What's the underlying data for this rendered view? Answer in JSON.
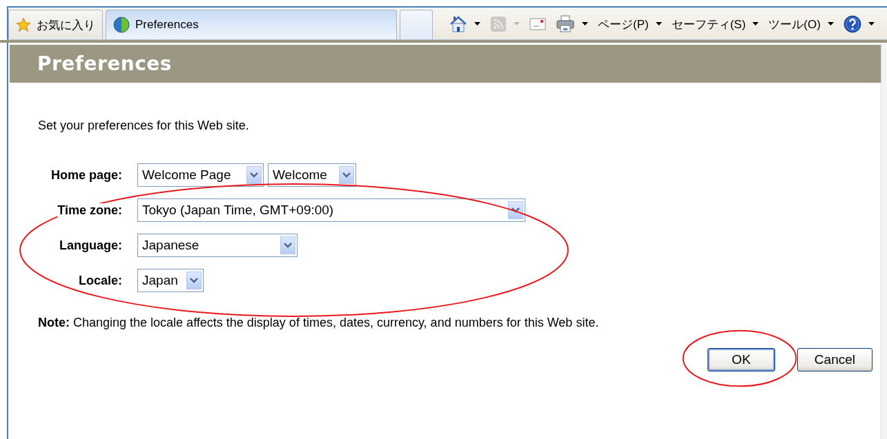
{
  "browser": {
    "tabs": [
      {
        "kind": "favorites",
        "label": "お気に入り",
        "selected": false
      },
      {
        "kind": "page",
        "label": "Preferences",
        "selected": true
      },
      {
        "kind": "new",
        "selected": false
      }
    ],
    "commands": [
      {
        "kind": "home",
        "dropdown": true,
        "disabled": false
      },
      {
        "kind": "feeds",
        "dropdown": true,
        "disabled": true
      },
      {
        "kind": "mail",
        "dropdown": false,
        "disabled": false
      },
      {
        "kind": "print",
        "dropdown": true,
        "disabled": false
      },
      {
        "kind": "menu",
        "label": "ページ(P)",
        "dropdown": true,
        "disabled": false
      },
      {
        "kind": "menu",
        "label": "セーフティ(S)",
        "dropdown": true,
        "disabled": false
      },
      {
        "kind": "menu",
        "label": "ツール(O)",
        "dropdown": true,
        "disabled": false
      },
      {
        "kind": "help",
        "dropdown": true,
        "disabled": false
      }
    ]
  },
  "page": {
    "title": "Preferences",
    "intro": "Set your preferences for this Web site.",
    "fields": [
      {
        "label": "Home page:",
        "selects": [
          "Welcome Page",
          "Welcome"
        ],
        "highlighted": false
      },
      {
        "label": "Time zone:",
        "selects": [
          "Tokyo (Japan Time, GMT+09:00)"
        ],
        "highlighted": true
      },
      {
        "label": "Language:",
        "selects": [
          "Japanese"
        ],
        "highlighted": true
      },
      {
        "label": "Locale:",
        "selects": [
          "Japan"
        ],
        "highlighted": true
      }
    ],
    "note": "**Note:** Changing the locale affects the display of times, dates, currency, and numbers for this Web site.",
    "buttons": [
      {
        "label": "OK",
        "default": true,
        "highlighted": true
      },
      {
        "label": "Cancel",
        "default": false,
        "highlighted": false
      }
    ]
  }
}
